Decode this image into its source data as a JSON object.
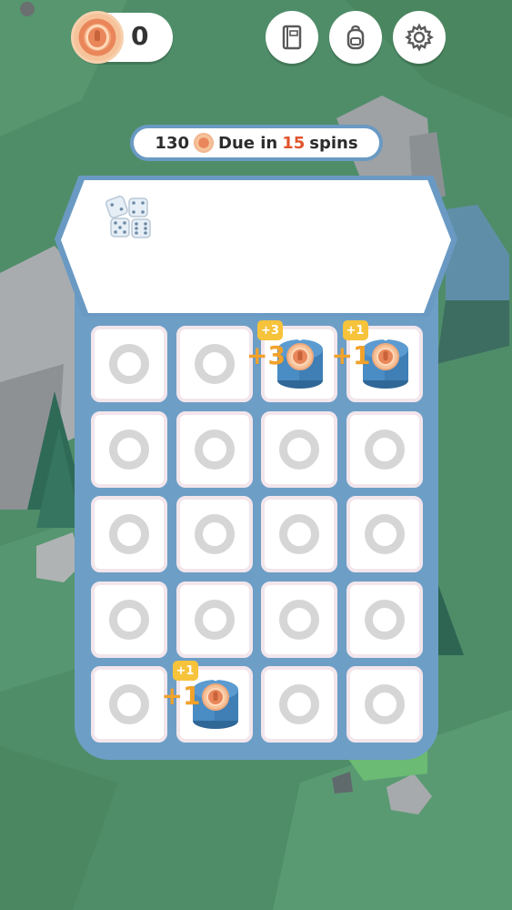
{
  "hud": {
    "coin_count": "0",
    "buttons": [
      {
        "name": "journal-button",
        "icon": "book-icon"
      },
      {
        "name": "backpack-button",
        "icon": "backpack-icon"
      },
      {
        "name": "settings-button",
        "icon": "gear-icon"
      }
    ]
  },
  "due": {
    "amount": "130",
    "text_before": "Due in",
    "spins": "15",
    "text_after": "spins"
  },
  "reel": {
    "items": [
      "dice-icon"
    ]
  },
  "grid": {
    "rows": 5,
    "cols": 4,
    "special_cells": [
      {
        "row": 0,
        "col": 2,
        "item": "coin-jar",
        "badge": "+3",
        "float": "+3"
      },
      {
        "row": 0,
        "col": 3,
        "item": "coin-jar",
        "badge": "+1",
        "float": "+1"
      },
      {
        "row": 4,
        "col": 1,
        "item": "coin-jar",
        "badge": "+1",
        "float": "+1"
      }
    ]
  },
  "colors": {
    "background": "#4f8d69",
    "machine": "#6d9ec6",
    "accent_orange": "#f2a22a",
    "due_red": "#e0542c"
  }
}
